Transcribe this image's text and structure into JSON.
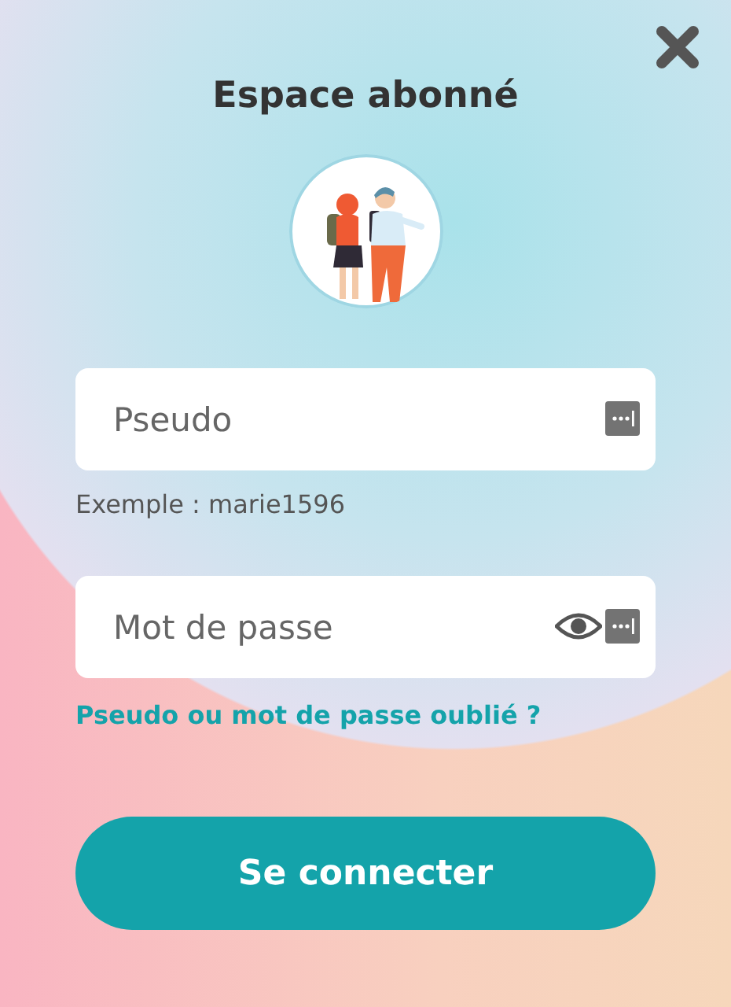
{
  "title": "Espace abonné",
  "fields": [
    {
      "kind": "text",
      "placeholder": "Pseudo",
      "hint": "Exemple : marie1596"
    },
    {
      "kind": "password",
      "placeholder": "Mot de passe"
    }
  ],
  "forgot_link": "Pseudo ou mot de passe oublié ?",
  "submit_button": "Se connecter"
}
